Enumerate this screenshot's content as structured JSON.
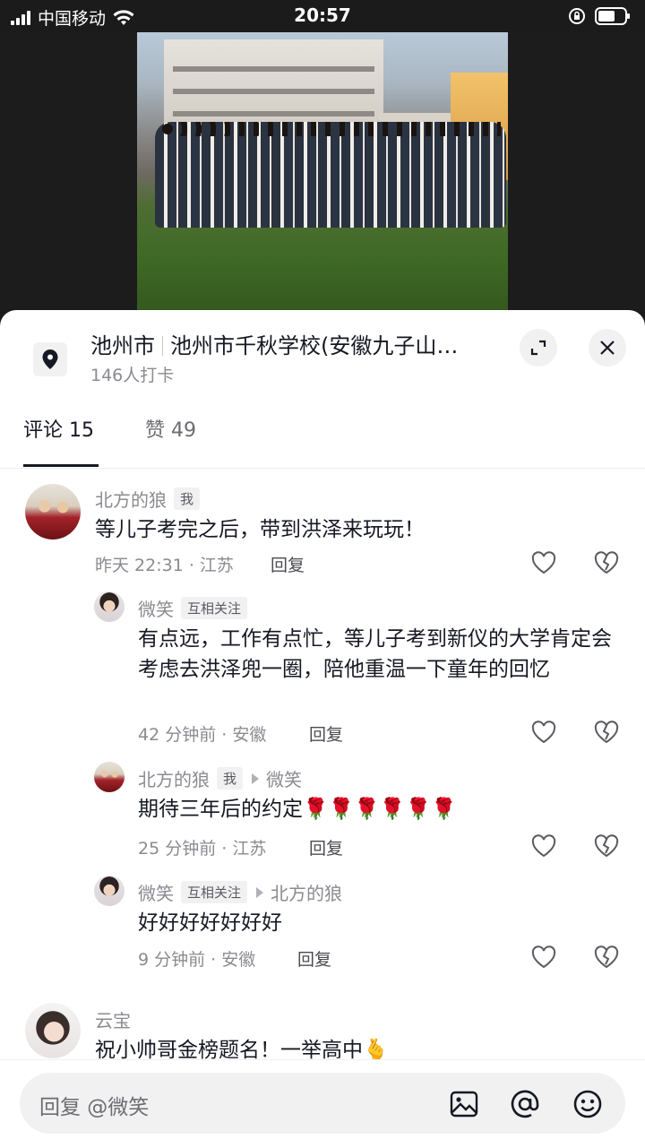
{
  "status_bar": {
    "carrier": "中国移动",
    "time": "20:57"
  },
  "location": {
    "city": "池州市",
    "place": "池州市千秋学校(安徽九子山…",
    "checkins": "146人打卡"
  },
  "tabs": [
    {
      "label": "评论 15"
    },
    {
      "label": "赞 49"
    }
  ],
  "comments": [
    {
      "user": "北方的狼",
      "tag": "我",
      "text": "等儿子考完之后，带到洪泽来玩玩！",
      "meta": "昨天 22:31 · 江苏",
      "reply": "回复"
    },
    {
      "user": "微笑",
      "tag": "互相关注",
      "text": "有点远，工作有点忙，等儿子考到新仪的大学肯定会考虑去洪泽兜一圈，陪他重温一下童年的回忆",
      "meta": "42 分钟前 · 安徽",
      "reply": "回复"
    },
    {
      "user": "北方的狼",
      "tag": "我",
      "reply_to": "微笑",
      "text": "期待三年后的约定🌹🌹🌹🌹🌹🌹",
      "meta": "25 分钟前 · 江苏",
      "reply": "回复"
    },
    {
      "user": "微笑",
      "tag": "互相关注",
      "reply_to": "北方的狼",
      "text": "好好好好好好好",
      "meta": "9 分钟前 · 安徽",
      "reply": "回复"
    },
    {
      "user": "云宝",
      "text": "祝小帅哥金榜题名！一举高中🫰"
    }
  ],
  "reply_box": {
    "placeholder": "回复 @微笑"
  },
  "icons": [
    "location-pin-icon",
    "expand-icon",
    "close-icon",
    "heart-icon",
    "broken-heart-icon",
    "image-icon",
    "at-icon",
    "emoji-icon"
  ]
}
